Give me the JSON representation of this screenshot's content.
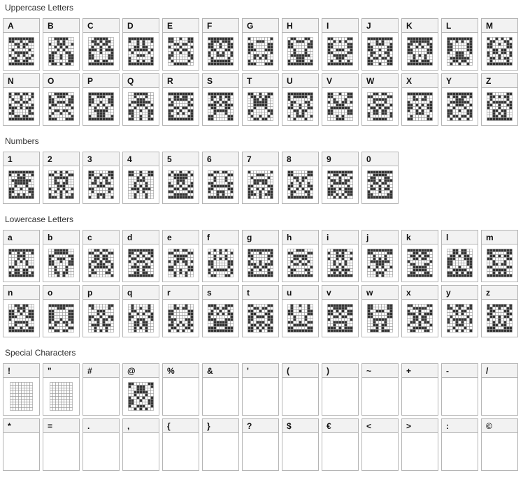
{
  "sections": [
    {
      "title": "Uppercase Letters",
      "rows": [
        [
          "A",
          "B",
          "C",
          "D",
          "E",
          "F",
          "G",
          "H",
          "I",
          "J",
          "K",
          "L",
          "M"
        ],
        [
          "N",
          "O",
          "P",
          "Q",
          "R",
          "S",
          "T",
          "U",
          "V",
          "W",
          "X",
          "Y",
          "Z"
        ]
      ]
    },
    {
      "title": "Numbers",
      "rows": [
        [
          "1",
          "2",
          "3",
          "4",
          "5",
          "6",
          "7",
          "8",
          "9",
          "0"
        ]
      ]
    },
    {
      "title": "Lowercase Letters",
      "rows": [
        [
          "a",
          "b",
          "c",
          "d",
          "e",
          "f",
          "g",
          "h",
          "i",
          "j",
          "k",
          "l",
          "m"
        ],
        [
          "n",
          "o",
          "p",
          "q",
          "r",
          "s",
          "t",
          "u",
          "v",
          "w",
          "x",
          "y",
          "z"
        ]
      ]
    },
    {
      "title": "Special Characters",
      "rows": [
        [
          "!",
          "\"",
          "#",
          "@",
          "%",
          "&",
          "'",
          "(",
          ")",
          "~",
          "+",
          "-",
          "/"
        ],
        [
          "*",
          "=",
          ".",
          ",",
          "{",
          "}",
          "?",
          "$",
          "€",
          "<",
          ">",
          ":",
          "©"
        ]
      ]
    }
  ],
  "empty_glyphs": [
    "#",
    "%",
    "&",
    "'",
    "(",
    ")",
    "~",
    "+",
    "-",
    "/",
    "*",
    "=",
    ".",
    ",",
    "{",
    "}",
    "?",
    "$",
    "€",
    "<",
    ">",
    ":",
    "©"
  ],
  "light_glyphs": [
    "!",
    "\""
  ],
  "colors": {
    "pixel_on": "#333333",
    "pixel_off": "#ffffff",
    "pixel_grid": "#9a9a9a"
  }
}
